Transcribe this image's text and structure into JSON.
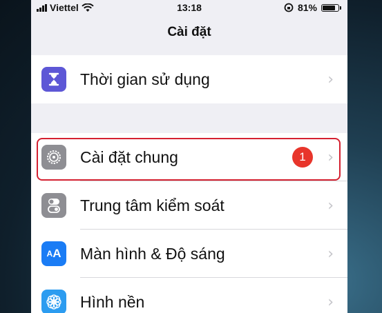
{
  "status_bar": {
    "carrier": "Viettel",
    "time": "13:18",
    "battery_percent": "81%",
    "battery_level": 0.81
  },
  "nav": {
    "title": "Cài đặt"
  },
  "rows": [
    {
      "label": "Thời gian sử dụng",
      "icon": "hourglass-icon",
      "icon_bg": "#5d57d6"
    },
    {
      "label": "Cài đặt chung",
      "icon": "gear-icon",
      "icon_bg": "#8e8e93",
      "badge": "1"
    },
    {
      "label": "Trung tâm kiểm soát",
      "icon": "toggles-icon",
      "icon_bg": "#8e8e93"
    },
    {
      "label": "Màn hình & Độ sáng",
      "icon": "text-size-icon",
      "icon_bg": "#1a7cf5"
    },
    {
      "label": "Hình nền",
      "icon": "flower-icon",
      "icon_bg": "#2c9cf0"
    }
  ],
  "colors": {
    "highlight": "#d42030",
    "badge": "#e8352b"
  }
}
